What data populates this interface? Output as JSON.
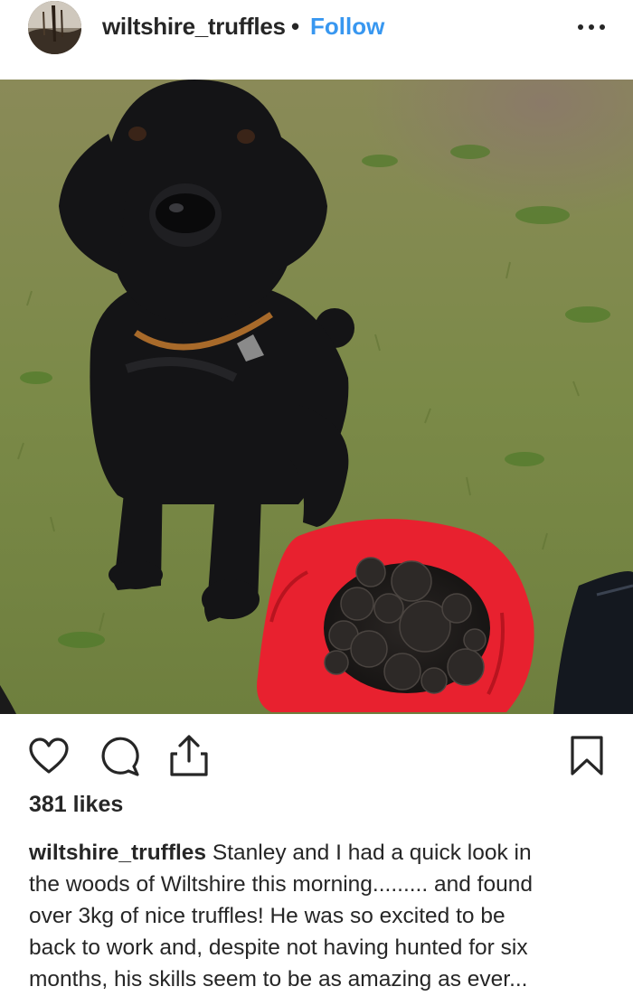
{
  "post": {
    "username": "wiltshire_truffles",
    "separator": "•",
    "follow_label": "Follow",
    "more_icon": "more-options-icon"
  },
  "photo": {
    "description_icon": "post-photo"
  },
  "actions": {
    "like_icon": "heart-icon",
    "comment_icon": "comment-icon",
    "share_icon": "share-icon",
    "save_icon": "bookmark-icon"
  },
  "likes": {
    "label": "381 likes"
  },
  "caption": {
    "username": "wiltshire_truffles",
    "lines": [
      " Stanley and I had a quick look in",
      "the woods of Wiltshire this morning......... and found",
      "over 3kg of nice truffles! He was so excited to be",
      "back to work and, despite not having hunted for six",
      "months, his skills seem to be as amazing as ever..."
    ]
  },
  "colors": {
    "text": "#262626",
    "link": "#3897f0",
    "bag_red": "#e8212f",
    "grass": "#7a8a45"
  }
}
